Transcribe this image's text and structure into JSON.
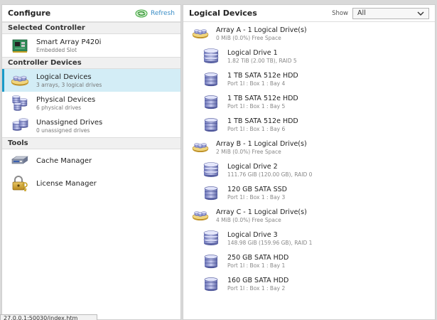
{
  "left": {
    "title": "Configure",
    "refresh_label": "Refresh",
    "sections": {
      "selected_controller": "Selected Controller",
      "controller_devices": "Controller Devices",
      "tools": "Tools"
    },
    "controller": {
      "label": "Smart Array P420i",
      "sub": "Embedded Slot",
      "icon": "raid-controller-icon"
    },
    "devices": [
      {
        "label": "Logical Devices",
        "sub": "3 arrays, 3 logical drives",
        "icon": "logical-devices-icon"
      },
      {
        "label": "Physical Devices",
        "sub": "6 physical drives",
        "icon": "physical-devices-icon"
      },
      {
        "label": "Unassigned Drives",
        "sub": "0 unassigned drives",
        "icon": "unassigned-drives-icon"
      }
    ],
    "tools": [
      {
        "label": "Cache Manager",
        "icon": "cache-manager-icon"
      },
      {
        "label": "License Manager",
        "icon": "license-manager-icon"
      }
    ]
  },
  "right": {
    "title": "Logical Devices",
    "show_label": "Show",
    "show_value": "All",
    "arrays": [
      {
        "label": "Array A - 1 Logical Drive(s)",
        "sub": "0 MiB (0.0%) Free Space",
        "logical_drive": {
          "label": "Logical Drive 1",
          "sub": "1.82 TiB (2.00 TB), RAID 5"
        },
        "physical_drives": [
          {
            "label": "1 TB SATA 512e HDD",
            "sub": "Port 1I : Box 1 : Bay 4"
          },
          {
            "label": "1 TB SATA 512e HDD",
            "sub": "Port 1I : Box 1 : Bay 5"
          },
          {
            "label": "1 TB SATA 512e HDD",
            "sub": "Port 1I : Box 1 : Bay 6"
          }
        ]
      },
      {
        "label": "Array B - 1 Logical Drive(s)",
        "sub": "2 MiB (0.0%) Free Space",
        "logical_drive": {
          "label": "Logical Drive 2",
          "sub": "111.76 GiB (120.00 GB), RAID 0"
        },
        "physical_drives": [
          {
            "label": "120 GB SATA SSD",
            "sub": "Port 1I : Box 1 : Bay 3"
          }
        ]
      },
      {
        "label": "Array C - 1 Logical Drive(s)",
        "sub": "4 MiB (0.0%) Free Space",
        "logical_drive": {
          "label": "Logical Drive 3",
          "sub": "148.98 GiB (159.96 GB), RAID 1"
        },
        "physical_drives": [
          {
            "label": "250 GB SATA HDD",
            "sub": "Port 1I : Box 1 : Bay 1"
          },
          {
            "label": "160 GB SATA HDD",
            "sub": "Port 1I : Box 1 : Bay 2"
          }
        ]
      }
    ]
  },
  "statusbar": {
    "text": "27.0.0.1:50030/index.htm"
  },
  "colors": {
    "accent": "#1a9ac9",
    "selected_bg": "#d3edf6",
    "refresh": "#3b8ec6"
  }
}
